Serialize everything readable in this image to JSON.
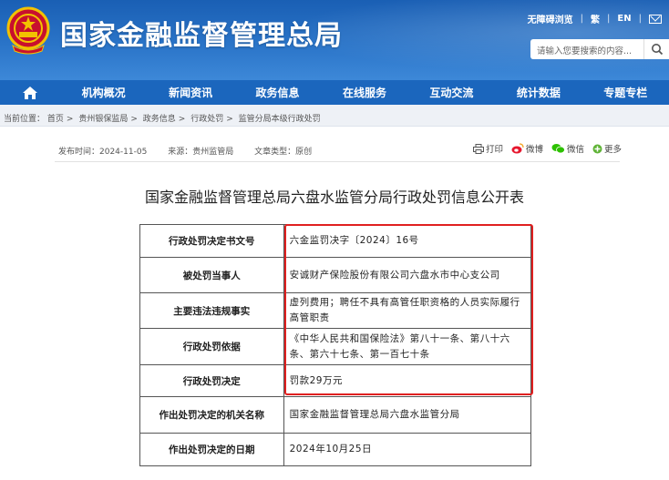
{
  "header": {
    "site_title": "国家金融监督管理总局",
    "accessible_link": "无障碍浏览",
    "traditional_link": "繁",
    "english_link": "EN",
    "search_placeholder": "请输入您要搜索的内容..."
  },
  "nav": {
    "items": [
      "机构概况",
      "新闻资讯",
      "政务信息",
      "在线服务",
      "互动交流",
      "统计数据",
      "专题专栏"
    ]
  },
  "breadcrumb": {
    "prefix": "当前位置：",
    "items": [
      "首页",
      "贵州银保监局",
      "政务信息",
      "行政处罚",
      "监管分局本级行政处罚"
    ]
  },
  "meta": {
    "publish_date": "发布时间：2024-11-05",
    "source": "来源：贵州监管局",
    "doc_type": "文章类型：原创"
  },
  "share": {
    "print": "打印",
    "weibo": "微博",
    "wechat": "微信",
    "more": "更多"
  },
  "doc_title": "国家金融监督管理总局六盘水监管分局行政处罚信息公开表",
  "table": {
    "rows": [
      {
        "label": "行政处罚决定书文号",
        "value": "六金监罚决字〔2024〕16号"
      },
      {
        "label": "被处罚当事人",
        "value": "安诚财产保险股份有限公司六盘水市中心支公司"
      },
      {
        "label": "主要违法违规事实",
        "value": "虚列费用；聘任不具有高管任职资格的人员实际履行高管职责"
      },
      {
        "label": "行政处罚依据",
        "value": "《中华人民共和国保险法》第八十一条、第八十六条、第六十七条、第一百七十条"
      },
      {
        "label": "行政处罚决定",
        "value": "罚款29万元"
      },
      {
        "label": "作出处罚决定的机关名称",
        "value": "国家金融监督管理总局六盘水监管分局"
      },
      {
        "label": "作出处罚决定的日期",
        "value": "2024年10月25日"
      }
    ]
  },
  "colors": {
    "header_blue": "#1a5fb4",
    "nav_blue": "#1b66bd",
    "highlight_red": "#e02020"
  }
}
